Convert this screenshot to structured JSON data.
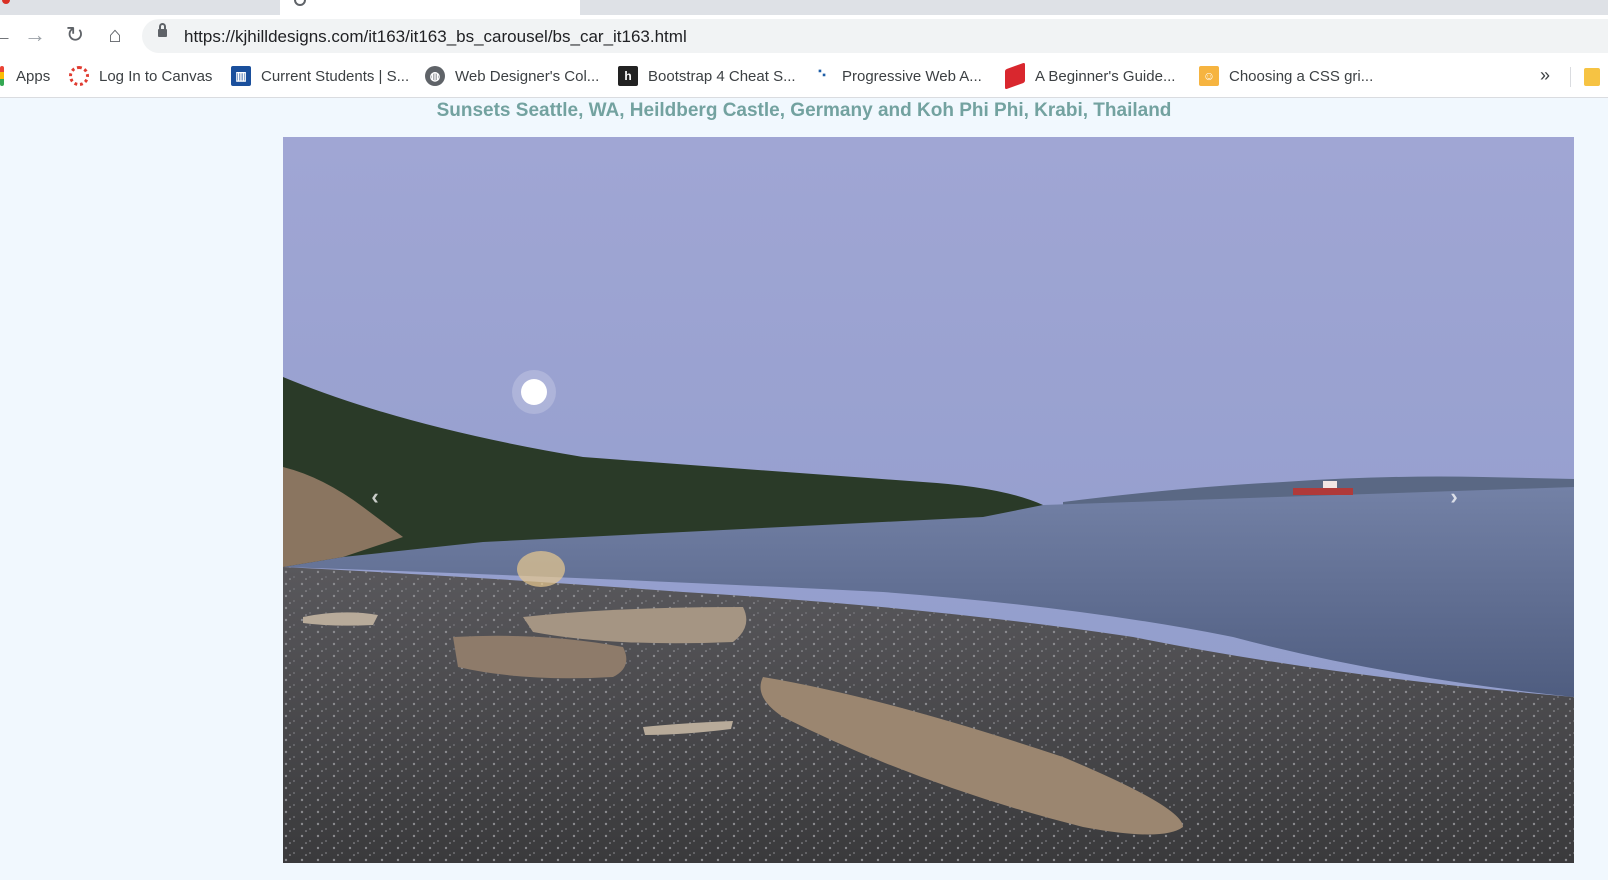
{
  "browser": {
    "url": "https://kjhilldesigns.com/it163/it163_bs_carousel/bs_car_it163.html",
    "nav_icons": [
      "back-icon",
      "forward-icon",
      "reload-icon",
      "home-icon",
      "lock-icon"
    ]
  },
  "bookmarks": {
    "items": [
      {
        "label": "Apps",
        "icon": "apps-icon"
      },
      {
        "label": "Log In to Canvas",
        "icon": "canvas-icon"
      },
      {
        "label": "Current Students | S...",
        "icon": "students-icon"
      },
      {
        "label": "Web Designer's Col...",
        "icon": "globe-icon"
      },
      {
        "label": "Bootstrap 4 Cheat S...",
        "icon": "h-icon"
      },
      {
        "label": "Progressive Web A...",
        "icon": "pwa-icon"
      },
      {
        "label": "A Beginner's Guide...",
        "icon": "beginner-icon"
      },
      {
        "label": "Choosing a CSS gri...",
        "icon": "css-icon"
      }
    ],
    "more": "»"
  },
  "page": {
    "title": "Sunsets Seattle, WA, Heildberg Castle, Germany and Koh Phi Phi, Krabi, Thailand",
    "title_color": "#73a2a0",
    "background": "#f1f8fe"
  },
  "carousel": {
    "prev_glyph": "‹",
    "next_glyph": "›"
  }
}
